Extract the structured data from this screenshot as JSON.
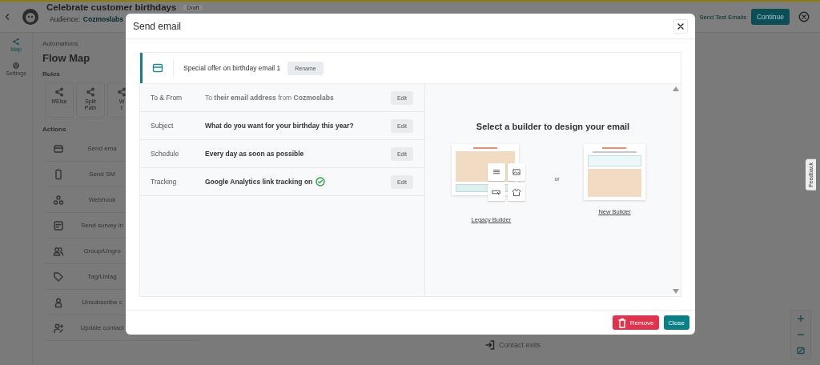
{
  "app_header": {
    "title": "Celebrate customer birthdays",
    "status_badge": "Draft",
    "audience_label": "Audience:",
    "audience": "Cozmoslabs",
    "send_test": "Send Test Emails",
    "continue": "Continue"
  },
  "rail": [
    {
      "label": "Map",
      "kind": "map",
      "selected": true
    },
    {
      "label": "Settings",
      "kind": "settings",
      "selected": false
    }
  ],
  "panel": {
    "breadcrumb": "Automations",
    "title": "Flow Map",
    "rules_heading": "Rules",
    "rules": [
      {
        "label": "If/Else"
      },
      {
        "label": "Split Path"
      },
      {
        "label": "W\nt"
      }
    ],
    "actions_heading": "Actions",
    "actions": [
      {
        "label": "Send ema",
        "kind": "mail"
      },
      {
        "label": "Send SM",
        "kind": "phone"
      },
      {
        "label": "Webhook",
        "kind": "webhook"
      },
      {
        "label": "Send survey in",
        "kind": "survey"
      },
      {
        "label": "Group/Ungro",
        "kind": "group"
      },
      {
        "label": "Tag/Untag",
        "kind": "tag"
      },
      {
        "label": "Unsubscribe c",
        "kind": "person"
      },
      {
        "label": "Update contact",
        "kind": "update"
      }
    ]
  },
  "canvas": {
    "exit_label": "Contact exits"
  },
  "feedback": "Feedback",
  "modal": {
    "title": "Send email",
    "email_name": "Special offer on birthday email 1",
    "rename": "Rename",
    "settings": [
      {
        "label": "To & From",
        "value": "To **their email address** from **Cozmoslabs**",
        "kind": "mixed",
        "verified": false,
        "edit": "Edit"
      },
      {
        "label": "Subject",
        "value": "What do you want for your birthday this year?",
        "kind": "text",
        "verified": false,
        "edit": "Edit"
      },
      {
        "label": "Schedule",
        "value": "Every day as soon as possible",
        "kind": "text",
        "verified": false,
        "edit": "Edit"
      },
      {
        "label": "Tracking",
        "value": "Google Analytics link tracking on",
        "kind": "text",
        "verified": true,
        "edit": "Edit"
      }
    ],
    "builder": {
      "heading": "Select a builder to design your email",
      "separator": "or",
      "options": [
        {
          "label": "Legacy Builder",
          "kind": "legacy"
        },
        {
          "label": "New Builder",
          "kind": "new"
        }
      ]
    },
    "remove": "Remove",
    "close": "Close"
  }
}
